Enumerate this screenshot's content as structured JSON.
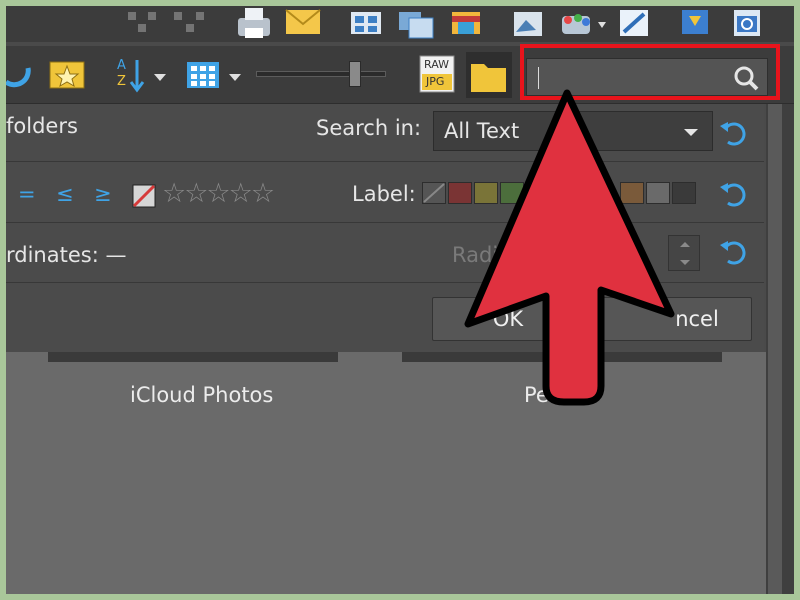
{
  "filter_row": {
    "subfolders_label": "folders",
    "search_in_label": "Search in:",
    "search_in_value": "All Text"
  },
  "rating_row": {
    "eq_symbol": "=",
    "le_symbol": "≤",
    "ge_symbol": "≥",
    "stars": "☆☆☆☆☆",
    "label_text": "Label:"
  },
  "coord_row": {
    "coordinates_label": "rdinates: —",
    "radius_label": "Radi"
  },
  "buttons": {
    "ok": "OK",
    "cancel": "ncel"
  },
  "toolbar": {
    "raw_text": "RAW",
    "jpg_text": "JPG",
    "sort_a": "A",
    "sort_z": "Z"
  },
  "folders": [
    {
      "name": "iCloud Photos"
    },
    {
      "name": "Pe"
    }
  ],
  "colors": {
    "highlight": "#e8141c",
    "arrow_fill": "#e0313f",
    "accent_blue": "#3fa3e6",
    "folder_yellow": "#f0c53a"
  }
}
